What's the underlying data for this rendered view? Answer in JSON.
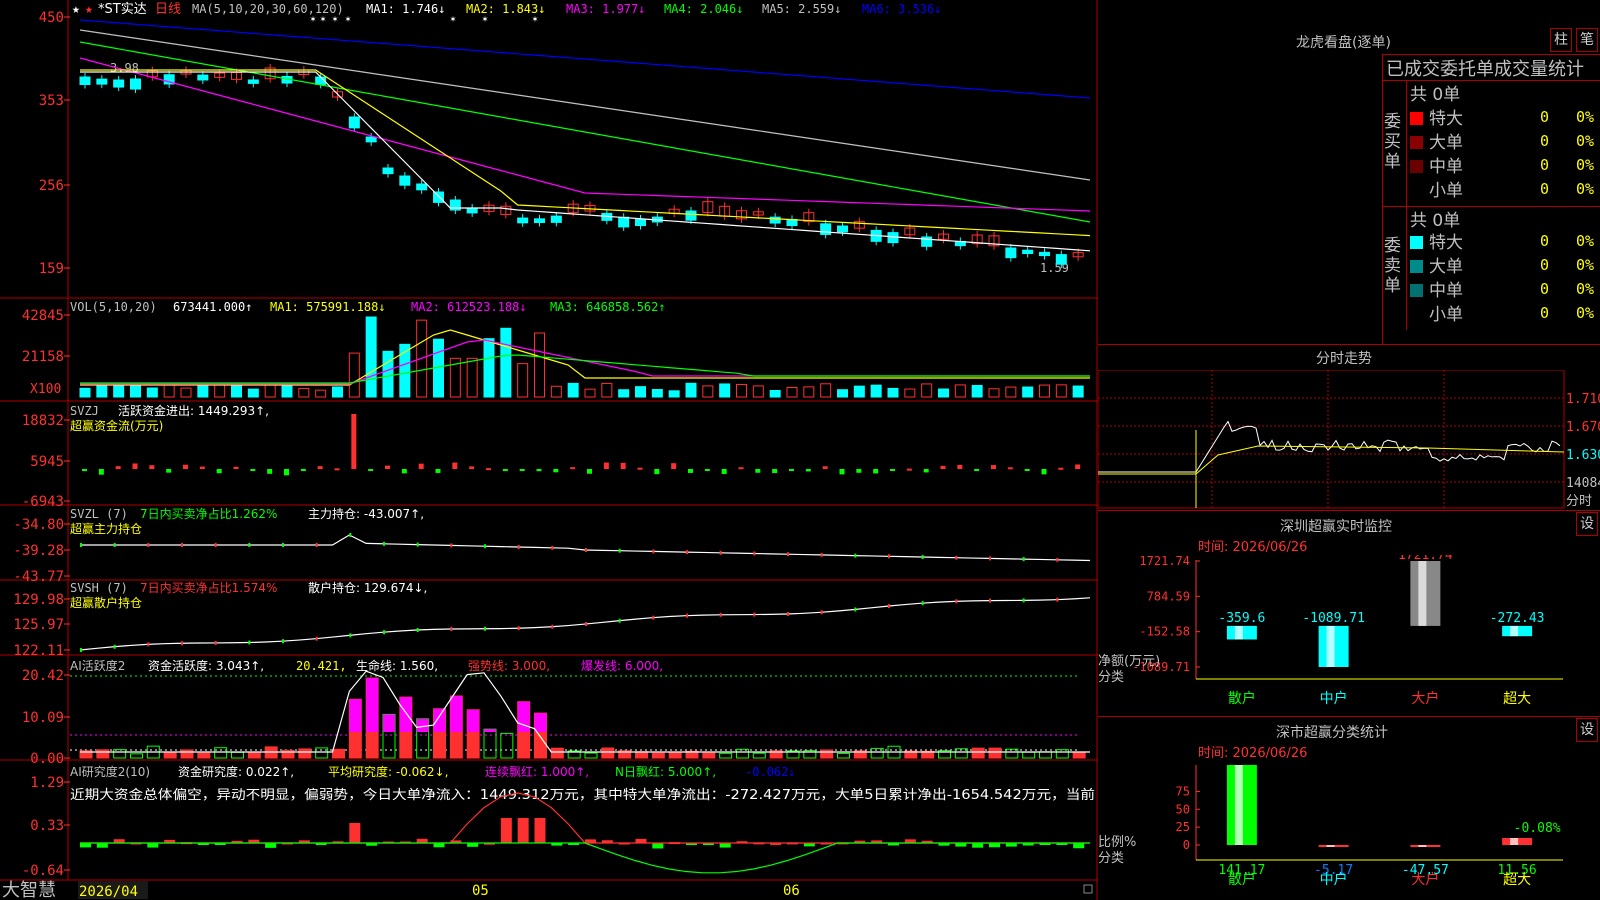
{
  "colors": {
    "up": "#ff3030",
    "down": "#00ffff",
    "ma1": "#ffffff",
    "ma2": "#ffff00",
    "ma3": "#ff00ff",
    "ma4": "#00ff00",
    "ma5": "#c0c0c0",
    "ma6": "#0000ff",
    "grid": "#b00000"
  },
  "main": {
    "header": {
      "title": "*ST实达",
      "period": "日线",
      "ma_params": "MA(5,10,20,30,60,120)",
      "ma1": "MA1: 1.746↓",
      "ma2": "MA2: 1.843↓",
      "ma3": "MA3: 1.977↓",
      "ma4": "MA4: 2.046↓",
      "ma5": "MA5: 2.559↓",
      "ma6": "MA6: 3.536↓"
    },
    "y_ticks": [
      "450",
      "353",
      "256",
      "159"
    ],
    "annot_high": "3.98",
    "annot_low": "1.59"
  },
  "vol": {
    "header": {
      "label": "VOL(5,10,20)",
      "value": "673441.000↑",
      "ma1": "MA1: 575991.188↓",
      "ma2": "MA2: 612523.188↓",
      "ma3": "MA3: 646858.562↑"
    },
    "y_ticks": [
      "42845",
      "21158"
    ],
    "unit": "X100"
  },
  "svzj": {
    "header": {
      "label": "SVZJ",
      "t1": "活跃资金进出: 1449.293↑,",
      "t2": "超赢资金流(万元)"
    },
    "y_ticks": [
      "18832",
      "5945",
      "-6943"
    ]
  },
  "svzl": {
    "header": {
      "label": "SVZL (7)",
      "t1": "7日内买卖净占比1.262%",
      "t2": "主力持仓: -43.007↑,",
      "t3": "超赢主力持仓"
    },
    "y_ticks": [
      "-34.80",
      "-39.28",
      "-43.77"
    ]
  },
  "svsh": {
    "header": {
      "label": "SVSH (7)",
      "t1": "7日内买卖净占比1.574%",
      "t2": "散户持仓: 129.674↓,",
      "t3": "超赢散户持仓"
    },
    "y_ticks": [
      "129.98",
      "125.97",
      "122.11"
    ]
  },
  "ai1": {
    "header": {
      "label": "AI活跃度2",
      "t1": "资金活跃度: 3.043↑,",
      "t2": "20.421,",
      "t3": "生命线: 1.560,",
      "t4": "强势线: 3.000,",
      "t5": "爆发线: 6.000,"
    },
    "y_ticks": [
      "20.42",
      "10.09",
      "0.00"
    ]
  },
  "ai2": {
    "header": {
      "label": "AI研究度2(10)",
      "t1": "资金研究度: 0.022↑,",
      "t2": "平均研究度: -0.062↓,",
      "t3": "连续飘红: 1.000↑,",
      "t4": "N日飘红: 5.000↑,",
      "t5": "-0.062↓"
    },
    "text": "近期大资金总体偏空，异动不明显，偏弱势，今日大单净流入：1449.312万元，其中特大单净流出：-272.427万元，大单5日累计净出-1654.542万元，当前",
    "y_ticks": [
      "1.29",
      "0.33",
      "-0.64"
    ]
  },
  "bottom": {
    "brand": "大智慧",
    "date_label": "2026/04",
    "m05": "05",
    "m06": "06"
  },
  "lhb": {
    "title": "龙虎看盘(逐单)",
    "btn1": "柱",
    "btn2": "笔",
    "tabs": "已成交委托单成交量统计",
    "buy": {
      "label": "委买单",
      "total": "共 0单",
      "rows": [
        {
          "name": "特大",
          "color": "#ff0000",
          "count": "0",
          "pct": "0%"
        },
        {
          "name": "大单",
          "color": "#8b0000",
          "count": "0",
          "pct": "0%"
        },
        {
          "name": "中单",
          "color": "#6b0000",
          "count": "0",
          "pct": "0%"
        },
        {
          "name": "小单",
          "color": "#000000",
          "count": "0",
          "pct": "0%"
        }
      ]
    },
    "sell": {
      "label": "委卖单",
      "total": "共 0单",
      "rows": [
        {
          "name": "特大",
          "color": "#00ffff",
          "count": "0",
          "pct": "0%"
        },
        {
          "name": "大单",
          "color": "#008b8b",
          "count": "0",
          "pct": "0%"
        },
        {
          "name": "中单",
          "color": "#007070",
          "count": "0",
          "pct": "0%"
        },
        {
          "name": "小单",
          "color": "#000000",
          "count": "0",
          "pct": "0%"
        }
      ]
    }
  },
  "fenshi": {
    "title": "分时走势",
    "p1": "1.710",
    "p2": "1.670",
    "p3": "1.630",
    "vol": "14084",
    "unit": "分时"
  },
  "sz_monitor": {
    "title": "深圳超赢实时监控",
    "btn": "设",
    "date": "时间: 2026/06/26",
    "y_ticks": [
      "1721.74",
      "784.59",
      "-152.58",
      "-1089.71"
    ],
    "ylabel": "净额(万元)",
    "xlabel": "分类",
    "bars": [
      {
        "cat": "散户",
        "value": -359.6,
        "label": "-359.6"
      },
      {
        "cat": "中户",
        "value": -1089.71,
        "label": "-1089.71"
      },
      {
        "cat": "大户",
        "value": 1721.74,
        "label": "1721.74"
      },
      {
        "cat": "超大",
        "value": -272.43,
        "label": "-272.43"
      }
    ]
  },
  "sz_class": {
    "title": "深市超赢分类统计",
    "btn": "设",
    "date": "时间: 2026/06/26",
    "y_ticks": [
      "75",
      "50",
      "25",
      "0"
    ],
    "ylabel": "比例%",
    "xlabel": "分类",
    "bars": [
      {
        "cat": "散户",
        "value": 141.17,
        "label": "141.17",
        "top_label": ""
      },
      {
        "cat": "中户",
        "value": -5.17,
        "label": "-5.17",
        "top_label": ""
      },
      {
        "cat": "大户",
        "value": -47.57,
        "label": "-47.57",
        "top_label": ""
      },
      {
        "cat": "超大",
        "value": 11.56,
        "label": "11.56",
        "top_label": "-0.08%"
      }
    ]
  }
}
